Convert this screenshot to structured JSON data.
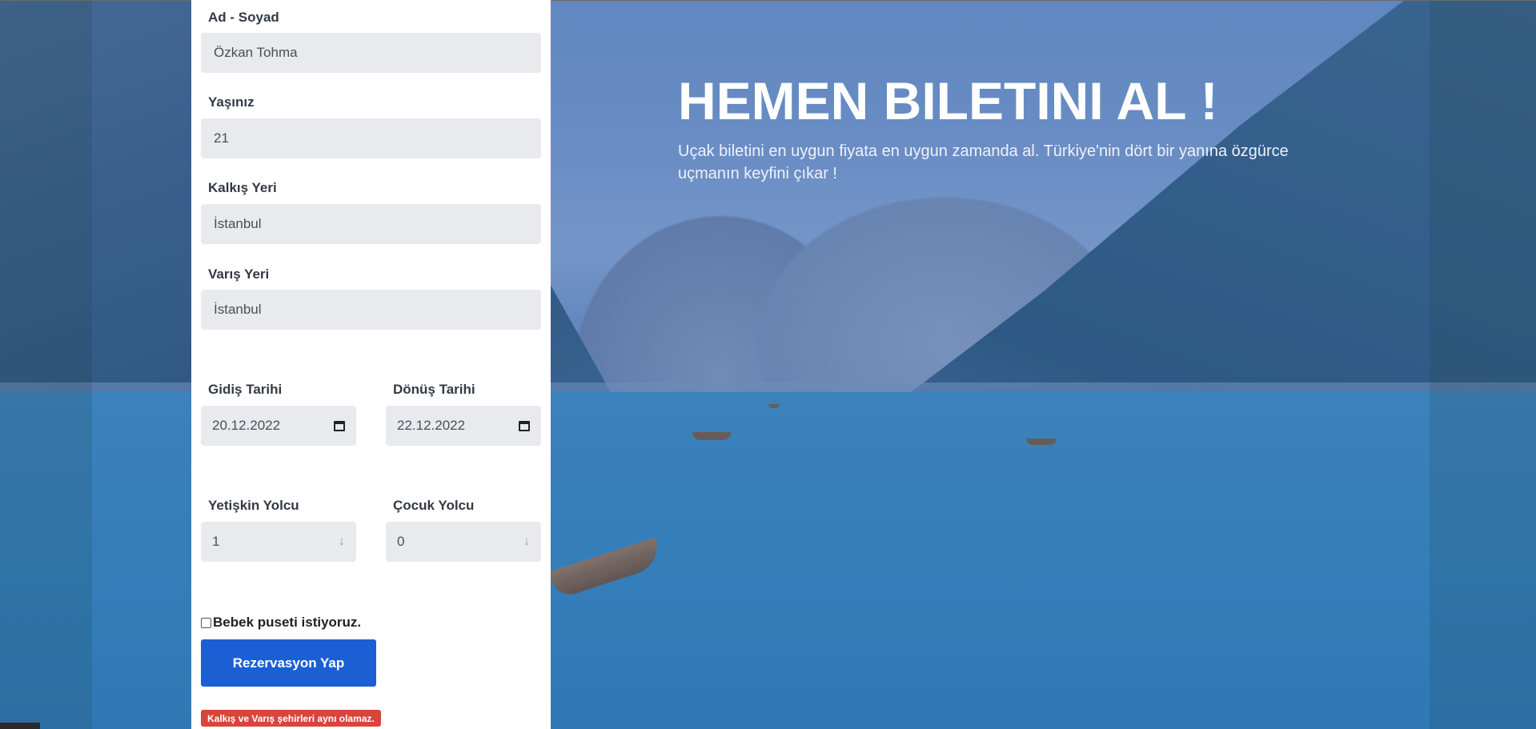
{
  "hero": {
    "title": "HEMEN BILETINI AL !",
    "subtitle": "Uçak biletini en uygun fiyata en uygun zamanda al. Türkiye'nin dört bir yanına özgürce uçmanın keyfini çıkar !"
  },
  "form": {
    "name": {
      "label": "Ad - Soyad",
      "value": "Özkan Tohma"
    },
    "age": {
      "label": "Yaşınız",
      "value": "21"
    },
    "departure": {
      "label": "Kalkış Yeri",
      "value": "İstanbul"
    },
    "arrival": {
      "label": "Varış Yeri",
      "value": "İstanbul"
    },
    "depart_date": {
      "label": "Gidiş Tarihi",
      "value": "20.12.2022"
    },
    "return_date": {
      "label": "Dönüş Tarihi",
      "value": "22.12.2022"
    },
    "adults": {
      "label": "Yetişkin Yolcu",
      "value": "1"
    },
    "children": {
      "label": "Çocuk Yolcu",
      "value": "0"
    },
    "crib_checkbox": {
      "label": "Bebek puseti istiyoruz.",
      "checked": false
    },
    "submit_label": "Rezervasyon Yap",
    "error_message": "Kalkış ve Varış şehirleri aynı olamaz."
  },
  "icons": {
    "calendar": "calendar-icon",
    "stepper": "arrow-down-icon"
  },
  "colors": {
    "button": "#1c5fd4",
    "error": "#d9443c",
    "input_bg": "#e8eaed"
  }
}
